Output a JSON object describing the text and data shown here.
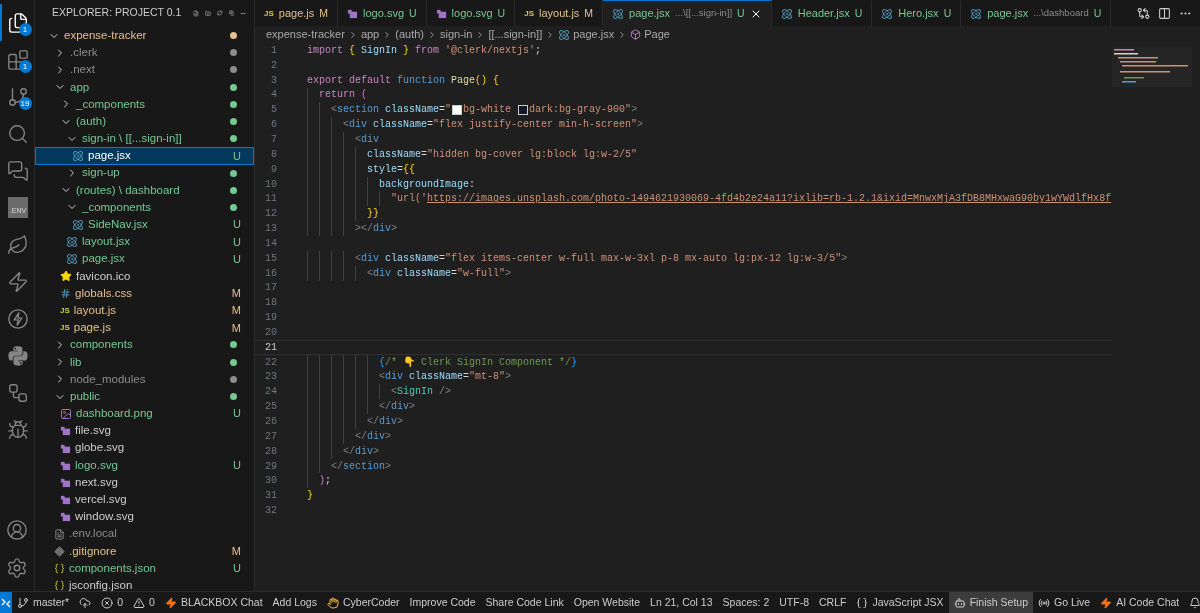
{
  "activity_bar": [
    {
      "kind": "explorer",
      "badge": "1",
      "selected": true
    },
    {
      "kind": "extensions",
      "badge": "1",
      "selected": false
    },
    {
      "kind": "source-control",
      "badge": "19",
      "selected": false
    },
    {
      "kind": "search",
      "selected": false
    },
    {
      "kind": "chat",
      "selected": false
    },
    {
      "kind": "env",
      "label": ".ENV",
      "selected": false
    },
    {
      "kind": "leaf",
      "selected": false
    },
    {
      "kind": "bolt",
      "selected": false
    },
    {
      "kind": "bolt-circle",
      "selected": false
    },
    {
      "kind": "python",
      "selected": false
    },
    {
      "kind": "diagram",
      "selected": false
    },
    {
      "kind": "run-debug",
      "selected": false
    }
  ],
  "activity_bottom": [
    {
      "kind": "account"
    },
    {
      "kind": "settings"
    }
  ],
  "sidebar": {
    "title": "EXPLORER: PROJECT 0.1",
    "tree": [
      {
        "name": "expense-tracker",
        "kind": "folder",
        "expanded": true,
        "selected": false,
        "color": "#e2c08d",
        "children": [
          {
            "name": ".clerk",
            "kind": "folder",
            "expanded": false,
            "selected": false,
            "color": "#8c8c8c"
          },
          {
            "name": ".next",
            "kind": "folder",
            "expanded": false,
            "selected": false,
            "color": "#8c8c8c"
          },
          {
            "name": "app",
            "kind": "folder",
            "expanded": true,
            "selected": false,
            "color": "#73c991",
            "children": [
              {
                "name": "_components",
                "kind": "folder",
                "expanded": false,
                "selected": false,
                "color": "#73c991"
              },
              {
                "name": "(auth)",
                "kind": "folder",
                "expanded": true,
                "selected": false,
                "color": "#73c991",
                "children": [
                  {
                    "name": "sign-in \\ [[...sign-in]]",
                    "kind": "folder",
                    "expanded": true,
                    "selected": false,
                    "color": "#73c991",
                    "children": [
                      {
                        "name": "page.jsx",
                        "kind": "react",
                        "selected": true,
                        "color": "#73c991",
                        "badge": "U"
                      }
                    ]
                  },
                  {
                    "name": "sign-up",
                    "kind": "folder",
                    "expanded": false,
                    "selected": false,
                    "color": "#73c991"
                  }
                ]
              },
              {
                "name": "(routes) \\ dashboard",
                "kind": "folder",
                "expanded": true,
                "selected": false,
                "color": "#73c991",
                "children": [
                  {
                    "name": "_components",
                    "kind": "folder",
                    "expanded": true,
                    "selected": false,
                    "color": "#73c991",
                    "children": [
                      {
                        "name": "SideNav.jsx",
                        "kind": "react",
                        "selected": false,
                        "color": "#73c991",
                        "badge": "U"
                      }
                    ]
                  },
                  {
                    "name": "layout.jsx",
                    "kind": "react",
                    "selected": false,
                    "color": "#73c991",
                    "badge": "U"
                  },
                  {
                    "name": "page.jsx",
                    "kind": "react",
                    "selected": false,
                    "color": "#73c991",
                    "badge": "U"
                  }
                ]
              },
              {
                "name": "favicon.ico",
                "kind": "star",
                "selected": false,
                "color": "#cccccc"
              },
              {
                "name": "globals.css",
                "kind": "css",
                "selected": false,
                "color": "#e2c08d",
                "badge": "M"
              },
              {
                "name": "layout.js",
                "kind": "js",
                "icon_text": "JS",
                "selected": false,
                "color": "#e2c08d",
                "badge": "M"
              },
              {
                "name": "page.js",
                "kind": "js",
                "icon_text": "JS",
                "selected": false,
                "color": "#e2c08d",
                "badge": "M"
              }
            ]
          },
          {
            "name": "components",
            "kind": "folder",
            "expanded": false,
            "selected": false,
            "color": "#73c991"
          },
          {
            "name": "lib",
            "kind": "folder",
            "expanded": false,
            "selected": false,
            "color": "#73c991"
          },
          {
            "name": "node_modules",
            "kind": "folder",
            "expanded": false,
            "selected": false,
            "color": "#8c8c8c"
          },
          {
            "name": "public",
            "kind": "folder",
            "expanded": true,
            "selected": false,
            "color": "#73c991",
            "children": [
              {
                "name": "dashboard.png",
                "kind": "image",
                "selected": false,
                "color": "#73c991",
                "badge": "U"
              },
              {
                "name": "file.svg",
                "kind": "svg",
                "selected": false,
                "color": "#cccccc"
              },
              {
                "name": "globe.svg",
                "kind": "svg",
                "selected": false,
                "color": "#cccccc"
              },
              {
                "name": "logo.svg",
                "kind": "svg",
                "selected": false,
                "color": "#73c991",
                "badge": "U"
              },
              {
                "name": "next.svg",
                "kind": "svg",
                "selected": false,
                "color": "#cccccc"
              },
              {
                "name": "vercel.svg",
                "kind": "svg",
                "selected": false,
                "color": "#cccccc"
              },
              {
                "name": "window.svg",
                "kind": "svg",
                "selected": false,
                "color": "#cccccc"
              }
            ]
          },
          {
            "name": ".env.local",
            "kind": "text",
            "selected": false,
            "color": "#8c8c8c"
          },
          {
            "name": ".gitignore",
            "kind": "git",
            "selected": false,
            "color": "#e2c08d",
            "badge": "M"
          },
          {
            "name": "components.json",
            "kind": "json",
            "selected": false,
            "color": "#73c991",
            "badge": "U"
          },
          {
            "name": "jsconfig.json",
            "kind": "json",
            "selected": false,
            "color": "#cccccc"
          }
        ]
      }
    ]
  },
  "tabs": [
    {
      "label": "page.js",
      "kind": "js",
      "icon_text": "JS",
      "badge": "M",
      "color": "#e2c08d",
      "selected": false
    },
    {
      "label": "logo.svg",
      "kind": "svg",
      "badge": "U",
      "color": "#73c991",
      "selected": false
    },
    {
      "label": "logo.svg",
      "kind": "svg",
      "badge": "U",
      "color": "#73c991",
      "selected": false
    },
    {
      "label": "layout.js",
      "kind": "js",
      "icon_text": "JS",
      "badge": "M",
      "color": "#e2c08d",
      "selected": false
    },
    {
      "label": "page.jsx",
      "description": "...\\[[...sign-in]]",
      "kind": "react",
      "badge": "U",
      "color": "#73c991",
      "selected": true
    },
    {
      "label": "Header.jsx",
      "kind": "react",
      "badge": "U",
      "color": "#73c991",
      "selected": false
    },
    {
      "label": "Hero.jsx",
      "kind": "react",
      "badge": "U",
      "color": "#73c991",
      "selected": false
    },
    {
      "label": "page.jsx",
      "description": "...\\dashboard",
      "kind": "react",
      "badge": "U",
      "color": "#73c991",
      "selected": false
    }
  ],
  "breadcrumb": [
    {
      "label": "expense-tracker",
      "kind": "folder"
    },
    {
      "label": "app",
      "kind": "folder"
    },
    {
      "label": "(auth)",
      "kind": "folder"
    },
    {
      "label": "sign-in",
      "kind": "folder"
    },
    {
      "label": "[[...sign-in]]",
      "kind": "folder"
    },
    {
      "label": "page.jsx",
      "kind": "react"
    },
    {
      "label": "Page",
      "kind": "symbol"
    }
  ],
  "code": [
    {
      "number": "1",
      "current": false,
      "tokens": [
        {
          "kind": "kw",
          "text": "import "
        },
        {
          "kind": "br1",
          "text": "{"
        },
        {
          "kind": "var",
          "text": " SignIn "
        },
        {
          "kind": "br1",
          "text": "}"
        },
        {
          "kind": "kw",
          "text": " from "
        },
        {
          "kind": "str",
          "text": "'@clerk/nextjs'"
        },
        {
          "kind": "pun",
          "text": ";"
        }
      ]
    },
    {
      "number": "2",
      "current": false
    },
    {
      "number": "3",
      "current": false,
      "tokens": [
        {
          "kind": "kw",
          "text": "export default "
        },
        {
          "kind": "st",
          "text": "function "
        },
        {
          "kind": "fn",
          "text": "Page"
        },
        {
          "kind": "br1",
          "text": "() {"
        }
      ]
    },
    {
      "number": "4",
      "current": false,
      "tokens": [
        {
          "kind": "kw",
          "text": "  return "
        },
        {
          "kind": "br2",
          "text": "("
        }
      ]
    },
    {
      "number": "5",
      "current": false,
      "tokens": [
        {
          "kind": "tag",
          "text": "    <"
        },
        {
          "kind": "st",
          "text": "section"
        },
        {
          "kind": "attr",
          "text": " className"
        },
        {
          "kind": "pun",
          "text": "="
        },
        {
          "kind": "str",
          "text": "\""
        },
        {
          "kind": "swatch",
          "color": "#ffffff"
        },
        {
          "kind": "str",
          "text": "bg-white "
        },
        {
          "kind": "swatch",
          "color": "#111827"
        },
        {
          "kind": "str",
          "text": "dark:bg-gray-900\""
        },
        {
          "kind": "tag",
          "text": ">"
        }
      ]
    },
    {
      "number": "6",
      "current": false,
      "tokens": [
        {
          "kind": "tag",
          "text": "      <"
        },
        {
          "kind": "st",
          "text": "div"
        },
        {
          "kind": "attr",
          "text": " className"
        },
        {
          "kind": "pun",
          "text": "="
        },
        {
          "kind": "str",
          "text": "\"flex justify-center min-h-screen\""
        },
        {
          "kind": "tag",
          "text": ">"
        }
      ]
    },
    {
      "number": "7",
      "current": false,
      "tokens": [
        {
          "kind": "tag",
          "text": "        <"
        },
        {
          "kind": "st",
          "text": "div"
        }
      ]
    },
    {
      "number": "8",
      "current": false,
      "tokens": [
        {
          "kind": "attr",
          "text": "          className"
        },
        {
          "kind": "pun",
          "text": "="
        },
        {
          "kind": "str",
          "text": "\"hidden bg-cover lg:block lg:w-2/5\""
        }
      ]
    },
    {
      "number": "9",
      "current": false,
      "tokens": [
        {
          "kind": "attr",
          "text": "          style"
        },
        {
          "kind": "pun",
          "text": "="
        },
        {
          "kind": "br1",
          "text": "{{"
        }
      ]
    },
    {
      "number": "10",
      "current": false,
      "tokens": [
        {
          "kind": "attr",
          "text": "            backgroundImage"
        },
        {
          "kind": "pun",
          "text": ":"
        }
      ]
    },
    {
      "number": "11",
      "current": false,
      "tokens": [
        {
          "kind": "str",
          "text": "              \"url('"
        },
        {
          "kind": "link",
          "text": "https://images.unsplash.com/photo-1494621930069-4fd4b2e24a11?ixlib=rb-1.2.1&ixid=MnwxMjA3fDB8MHxwaG90by1wYWdlfHx8f"
        }
      ]
    },
    {
      "number": "12",
      "current": false,
      "tokens": [
        {
          "kind": "br1",
          "text": "          }}"
        }
      ]
    },
    {
      "number": "13",
      "current": false,
      "tokens": [
        {
          "kind": "tag",
          "text": "        ></"
        },
        {
          "kind": "st",
          "text": "div"
        },
        {
          "kind": "tag",
          "text": ">"
        }
      ]
    },
    {
      "number": "14",
      "current": false
    },
    {
      "number": "15",
      "current": false,
      "tokens": [
        {
          "kind": "tag",
          "text": "        <"
        },
        {
          "kind": "st",
          "text": "div"
        },
        {
          "kind": "attr",
          "text": " className"
        },
        {
          "kind": "pun",
          "text": "="
        },
        {
          "kind": "str",
          "text": "\"flex items-center w-full max-w-3xl p-8 mx-auto lg:px-12 lg:w-3/5\""
        },
        {
          "kind": "tag",
          "text": ">"
        }
      ]
    },
    {
      "number": "16",
      "current": false,
      "tokens": [
        {
          "kind": "tag",
          "text": "          <"
        },
        {
          "kind": "st",
          "text": "div"
        },
        {
          "kind": "attr",
          "text": " className"
        },
        {
          "kind": "pun",
          "text": "="
        },
        {
          "kind": "str",
          "text": "\"w-full\""
        },
        {
          "kind": "tag",
          "text": ">"
        }
      ]
    },
    {
      "number": "17",
      "current": false
    },
    {
      "number": "18",
      "current": false
    },
    {
      "number": "19",
      "current": false
    },
    {
      "number": "20",
      "current": false
    },
    {
      "number": "21",
      "current": true
    },
    {
      "number": "22",
      "current": false,
      "tokens": [
        {
          "kind": "br3",
          "text": "            {"
        },
        {
          "kind": "com",
          "text": "/* 👇 Clerk SignIn Component */"
        },
        {
          "kind": "br3",
          "text": "}"
        }
      ]
    },
    {
      "number": "23",
      "current": false,
      "tokens": [
        {
          "kind": "tag",
          "text": "            <"
        },
        {
          "kind": "st",
          "text": "div"
        },
        {
          "kind": "attr",
          "text": " className"
        },
        {
          "kind": "pun",
          "text": "="
        },
        {
          "kind": "str",
          "text": "\"mt-8\""
        },
        {
          "kind": "tag",
          "text": ">"
        }
      ]
    },
    {
      "number": "24",
      "current": false,
      "tokens": [
        {
          "kind": "tag",
          "text": "              <"
        },
        {
          "kind": "comp",
          "text": "SignIn"
        },
        {
          "kind": "tag",
          "text": " />"
        }
      ]
    },
    {
      "number": "25",
      "current": false,
      "tokens": [
        {
          "kind": "tag",
          "text": "            </"
        },
        {
          "kind": "st",
          "text": "div"
        },
        {
          "kind": "tag",
          "text": ">"
        }
      ]
    },
    {
      "number": "26",
      "current": false,
      "tokens": [
        {
          "kind": "tag",
          "text": "          </"
        },
        {
          "kind": "st",
          "text": "div"
        },
        {
          "kind": "tag",
          "text": ">"
        }
      ]
    },
    {
      "number": "27",
      "current": false,
      "tokens": [
        {
          "kind": "tag",
          "text": "        </"
        },
        {
          "kind": "st",
          "text": "div"
        },
        {
          "kind": "tag",
          "text": ">"
        }
      ]
    },
    {
      "number": "28",
      "current": false,
      "tokens": [
        {
          "kind": "tag",
          "text": "      </"
        },
        {
          "kind": "st",
          "text": "div"
        },
        {
          "kind": "tag",
          "text": ">"
        }
      ]
    },
    {
      "number": "29",
      "current": false,
      "tokens": [
        {
          "kind": "tag",
          "text": "    </"
        },
        {
          "kind": "st",
          "text": "section"
        },
        {
          "kind": "tag",
          "text": ">"
        }
      ]
    },
    {
      "number": "30",
      "current": false,
      "tokens": [
        {
          "kind": "br2",
          "text": "  )"
        },
        {
          "kind": "pun",
          "text": ";"
        }
      ]
    },
    {
      "number": "31",
      "current": false,
      "tokens": [
        {
          "kind": "br1",
          "text": "}"
        }
      ]
    },
    {
      "number": "32",
      "current": false
    }
  ],
  "status_bar": {
    "left": [
      {
        "kind": "branch",
        "text": "master*"
      },
      {
        "kind": "sync"
      },
      {
        "kind": "errors",
        "text": "0"
      },
      {
        "kind": "warnings",
        "text": "0"
      },
      {
        "kind": "bolt",
        "text": "BLACKBOX Chat"
      },
      {
        "kind": "plain",
        "text": "Add Logs"
      },
      {
        "kind": "hand",
        "text": "CyberCoder"
      },
      {
        "kind": "plain",
        "text": "Improve Code"
      },
      {
        "kind": "plain",
        "text": "Share Code Link"
      },
      {
        "kind": "plain",
        "text": "Open Website"
      }
    ],
    "right": [
      {
        "kind": "plain",
        "text": "Ln 21, Col 13"
      },
      {
        "kind": "plain",
        "text": "Spaces: 2"
      },
      {
        "kind": "plain",
        "text": "UTF-8"
      },
      {
        "kind": "plain",
        "text": "CRLF"
      },
      {
        "kind": "braces",
        "text": "JavaScript JSX"
      },
      {
        "kind": "copilot",
        "text": "Finish Setup",
        "highlighted": true
      },
      {
        "kind": "broadcast",
        "text": "Go Live"
      },
      {
        "kind": "bolt",
        "text": "AI Code Chat"
      },
      {
        "kind": "bell"
      }
    ]
  }
}
